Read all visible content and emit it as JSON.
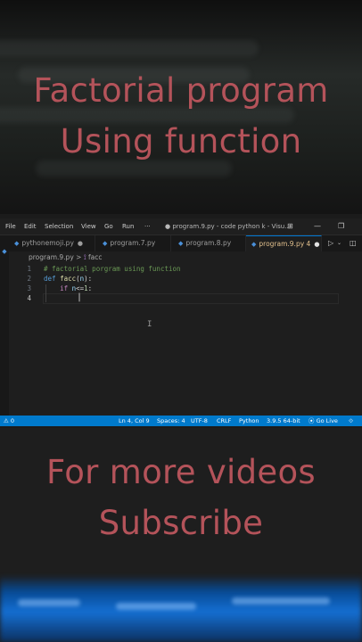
{
  "top_banner": {
    "line1": "Factorial program",
    "line2": "Using function"
  },
  "bottom_banner": {
    "line1": "For more videos",
    "line2": "Subscribe"
  },
  "menu": [
    "File",
    "Edit",
    "Selection",
    "View",
    "Go",
    "Run",
    "···"
  ],
  "window_title": "● program.9.py - code python k - Visu...",
  "window_buttons": {
    "layout": "⊞",
    "minimize": "—",
    "restore": "❐"
  },
  "tabs": [
    {
      "name": "pythonemoji.py",
      "marker": "●"
    },
    {
      "name": "program.7.py",
      "marker": ""
    },
    {
      "name": "program.8.py",
      "marker": ""
    },
    {
      "name": "program.9.py",
      "marker": "4",
      "dot": "●"
    }
  ],
  "breadcrumb": {
    "file": "program.9.py",
    "separator": ">",
    "symbol": "facc"
  },
  "code": {
    "line_numbers": [
      "1",
      "2",
      "3",
      "4"
    ],
    "l1_comment": "# factorial porgram using function",
    "l2_def": "def",
    "l2_name": "facc",
    "l2_open": "(",
    "l2_param": "n",
    "l2_close": "):",
    "l3_if": "if",
    "l3_var": "n",
    "l3_op": "<=",
    "l3_num": "1",
    "l3_colon": ":"
  },
  "status": {
    "problems": "⚠ 0",
    "position": "Ln 4, Col 9",
    "spaces": "Spaces: 4",
    "encoding": "UTF-8",
    "eol": "CRLF",
    "language": "Python",
    "interpreter": "3.9.5 64-bit",
    "go_live": "⦿ Go Live"
  },
  "colors": {
    "banner_text": "#b4535a",
    "status_bar": "#007acc",
    "accent": "#0078d4"
  }
}
